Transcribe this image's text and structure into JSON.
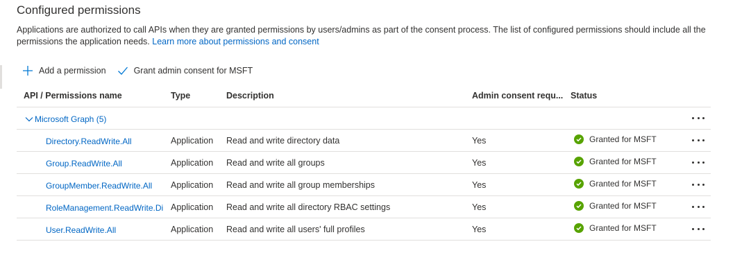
{
  "section": {
    "title": "Configured permissions",
    "description": "Applications are authorized to call APIs when they are granted permissions by users/admins as part of the consent process. The list of configured permissions should include all the permissions the application needs.",
    "learn_more": "Learn more about permissions and consent"
  },
  "toolbar": {
    "add_permission": "Add a permission",
    "grant_consent": "Grant admin consent for MSFT"
  },
  "table": {
    "headers": {
      "api": "API / Permissions name",
      "type": "Type",
      "description": "Description",
      "admin_consent": "Admin consent requ...",
      "status": "Status"
    },
    "group": {
      "label": "Microsoft Graph (5)"
    },
    "rows": [
      {
        "name": "Directory.ReadWrite.All",
        "type": "Application",
        "description": "Read and write directory data",
        "admin_consent": "Yes",
        "status": "Granted for MSFT"
      },
      {
        "name": "Group.ReadWrite.All",
        "type": "Application",
        "description": "Read and write all groups",
        "admin_consent": "Yes",
        "status": "Granted for MSFT"
      },
      {
        "name": "GroupMember.ReadWrite.All",
        "type": "Application",
        "description": "Read and write all group memberships",
        "admin_consent": "Yes",
        "status": "Granted for MSFT"
      },
      {
        "name": "RoleManagement.ReadWrite.Dir",
        "type": "Application",
        "description": "Read and write all directory RBAC settings",
        "admin_consent": "Yes",
        "status": "Granted for MSFT"
      },
      {
        "name": "User.ReadWrite.All",
        "type": "Application",
        "description": "Read and write all users' full profiles",
        "admin_consent": "Yes",
        "status": "Granted for MSFT"
      }
    ]
  },
  "icons": {
    "add": "plus-icon",
    "grant": "checkmark-icon",
    "expand": "chevron-down-icon",
    "status": "check-circle-icon",
    "more": "more-icon"
  },
  "colors": {
    "link": "#0066c4",
    "accent": "#0078d4",
    "granted": "#57a300",
    "divider": "#e1dfdd"
  }
}
